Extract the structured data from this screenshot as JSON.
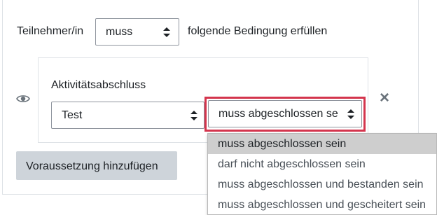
{
  "condition_header": {
    "prefix": "Teilnehmer/in",
    "mode_select_value": "muss",
    "suffix": "folgende Bedingung erfüllen"
  },
  "restriction": {
    "type_label": "Aktivitätsabschluss",
    "activity_select_value": "Test",
    "completion_select_value": "muss abgeschlossen se",
    "visibility_icon": "eye-icon",
    "delete_icon": "close-icon"
  },
  "add_button_label": "Voraussetzung hinzufügen",
  "completion_options": [
    {
      "label": "muss abgeschlossen sein",
      "selected": true
    },
    {
      "label": "darf nicht abgeschlossen sein",
      "selected": false
    },
    {
      "label": "muss abgeschlossen und bestanden sein",
      "selected": false
    },
    {
      "label": "muss abgeschlossen und gescheitert sein",
      "selected": false
    }
  ],
  "colors": {
    "highlight_border": "#d4354d",
    "selected_option_bg": "#cecece",
    "button_bg": "#ced4da"
  }
}
